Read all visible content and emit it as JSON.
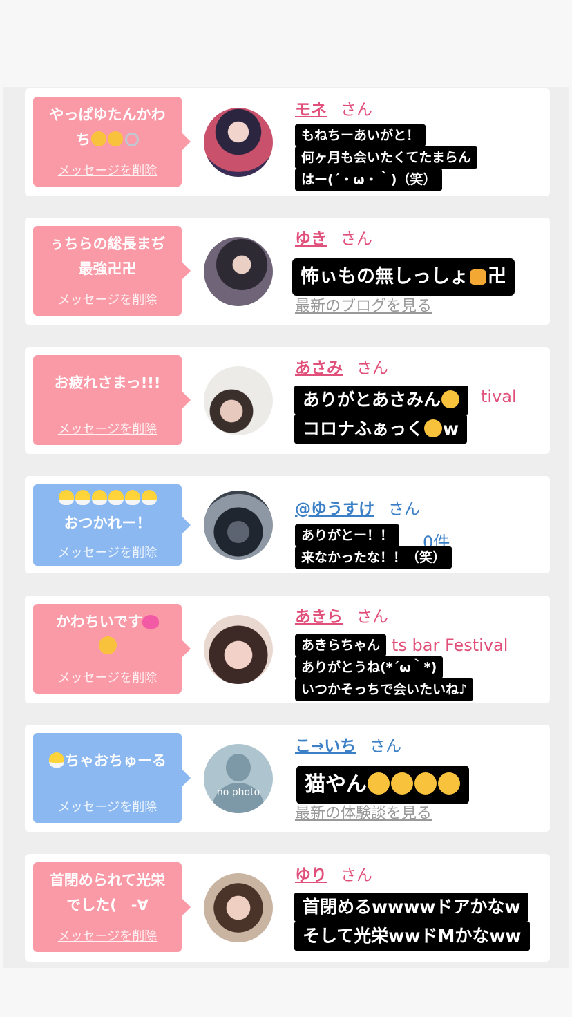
{
  "delete_label": "メッセージを削除",
  "san": "さん",
  "cards": [
    {
      "bubble": [
        "やっぱゆたんかわ",
        "ち"
      ],
      "name": "モネ",
      "sticker": [
        "もねちーあいがと！",
        "何ヶ月も会いたくてたまらん",
        "はー(´・ω・｀)（笑）"
      ]
    },
    {
      "bubble": [
        "ぅちらの総長まぢ",
        "最強卍卍"
      ],
      "name": "ゆき",
      "sub": "最新のブログを見る",
      "sticker": [
        "怖ぃもの無しっしょ",
        "卍"
      ]
    },
    {
      "bubble": [
        "お疲れさまっ!!!"
      ],
      "name": "あさみ",
      "sub": "tival",
      "sticker": [
        "ありがとあさみん",
        "コロナふぁっく",
        "w"
      ]
    },
    {
      "bubble": [
        "おつかれー！"
      ],
      "name": "@ゆうすけ",
      "sub": "0件",
      "sticker": [
        "ありがとー！！",
        "来なかったな！！（笑）"
      ]
    },
    {
      "bubble": [
        "かわちいです"
      ],
      "name": "あきら",
      "sub": "ts bar Festival",
      "sticker": [
        "あきらちゃん",
        "ありがとうね(*´ω｀*)",
        "いつかそっちで会いたいね♪"
      ]
    },
    {
      "bubble": [
        "ちゃおちゅーる"
      ],
      "name": "こ→いち",
      "sub": "最新の体験談を見る",
      "avatar_text": "no photo",
      "sticker": [
        "猫やん"
      ]
    },
    {
      "bubble": [
        "首閉められて光栄",
        "でした(　-∀"
      ],
      "name": "ゆり",
      "sticker": [
        "首閉めるwwwwドアかなw",
        "そして光栄wwドMかなww"
      ]
    }
  ]
}
